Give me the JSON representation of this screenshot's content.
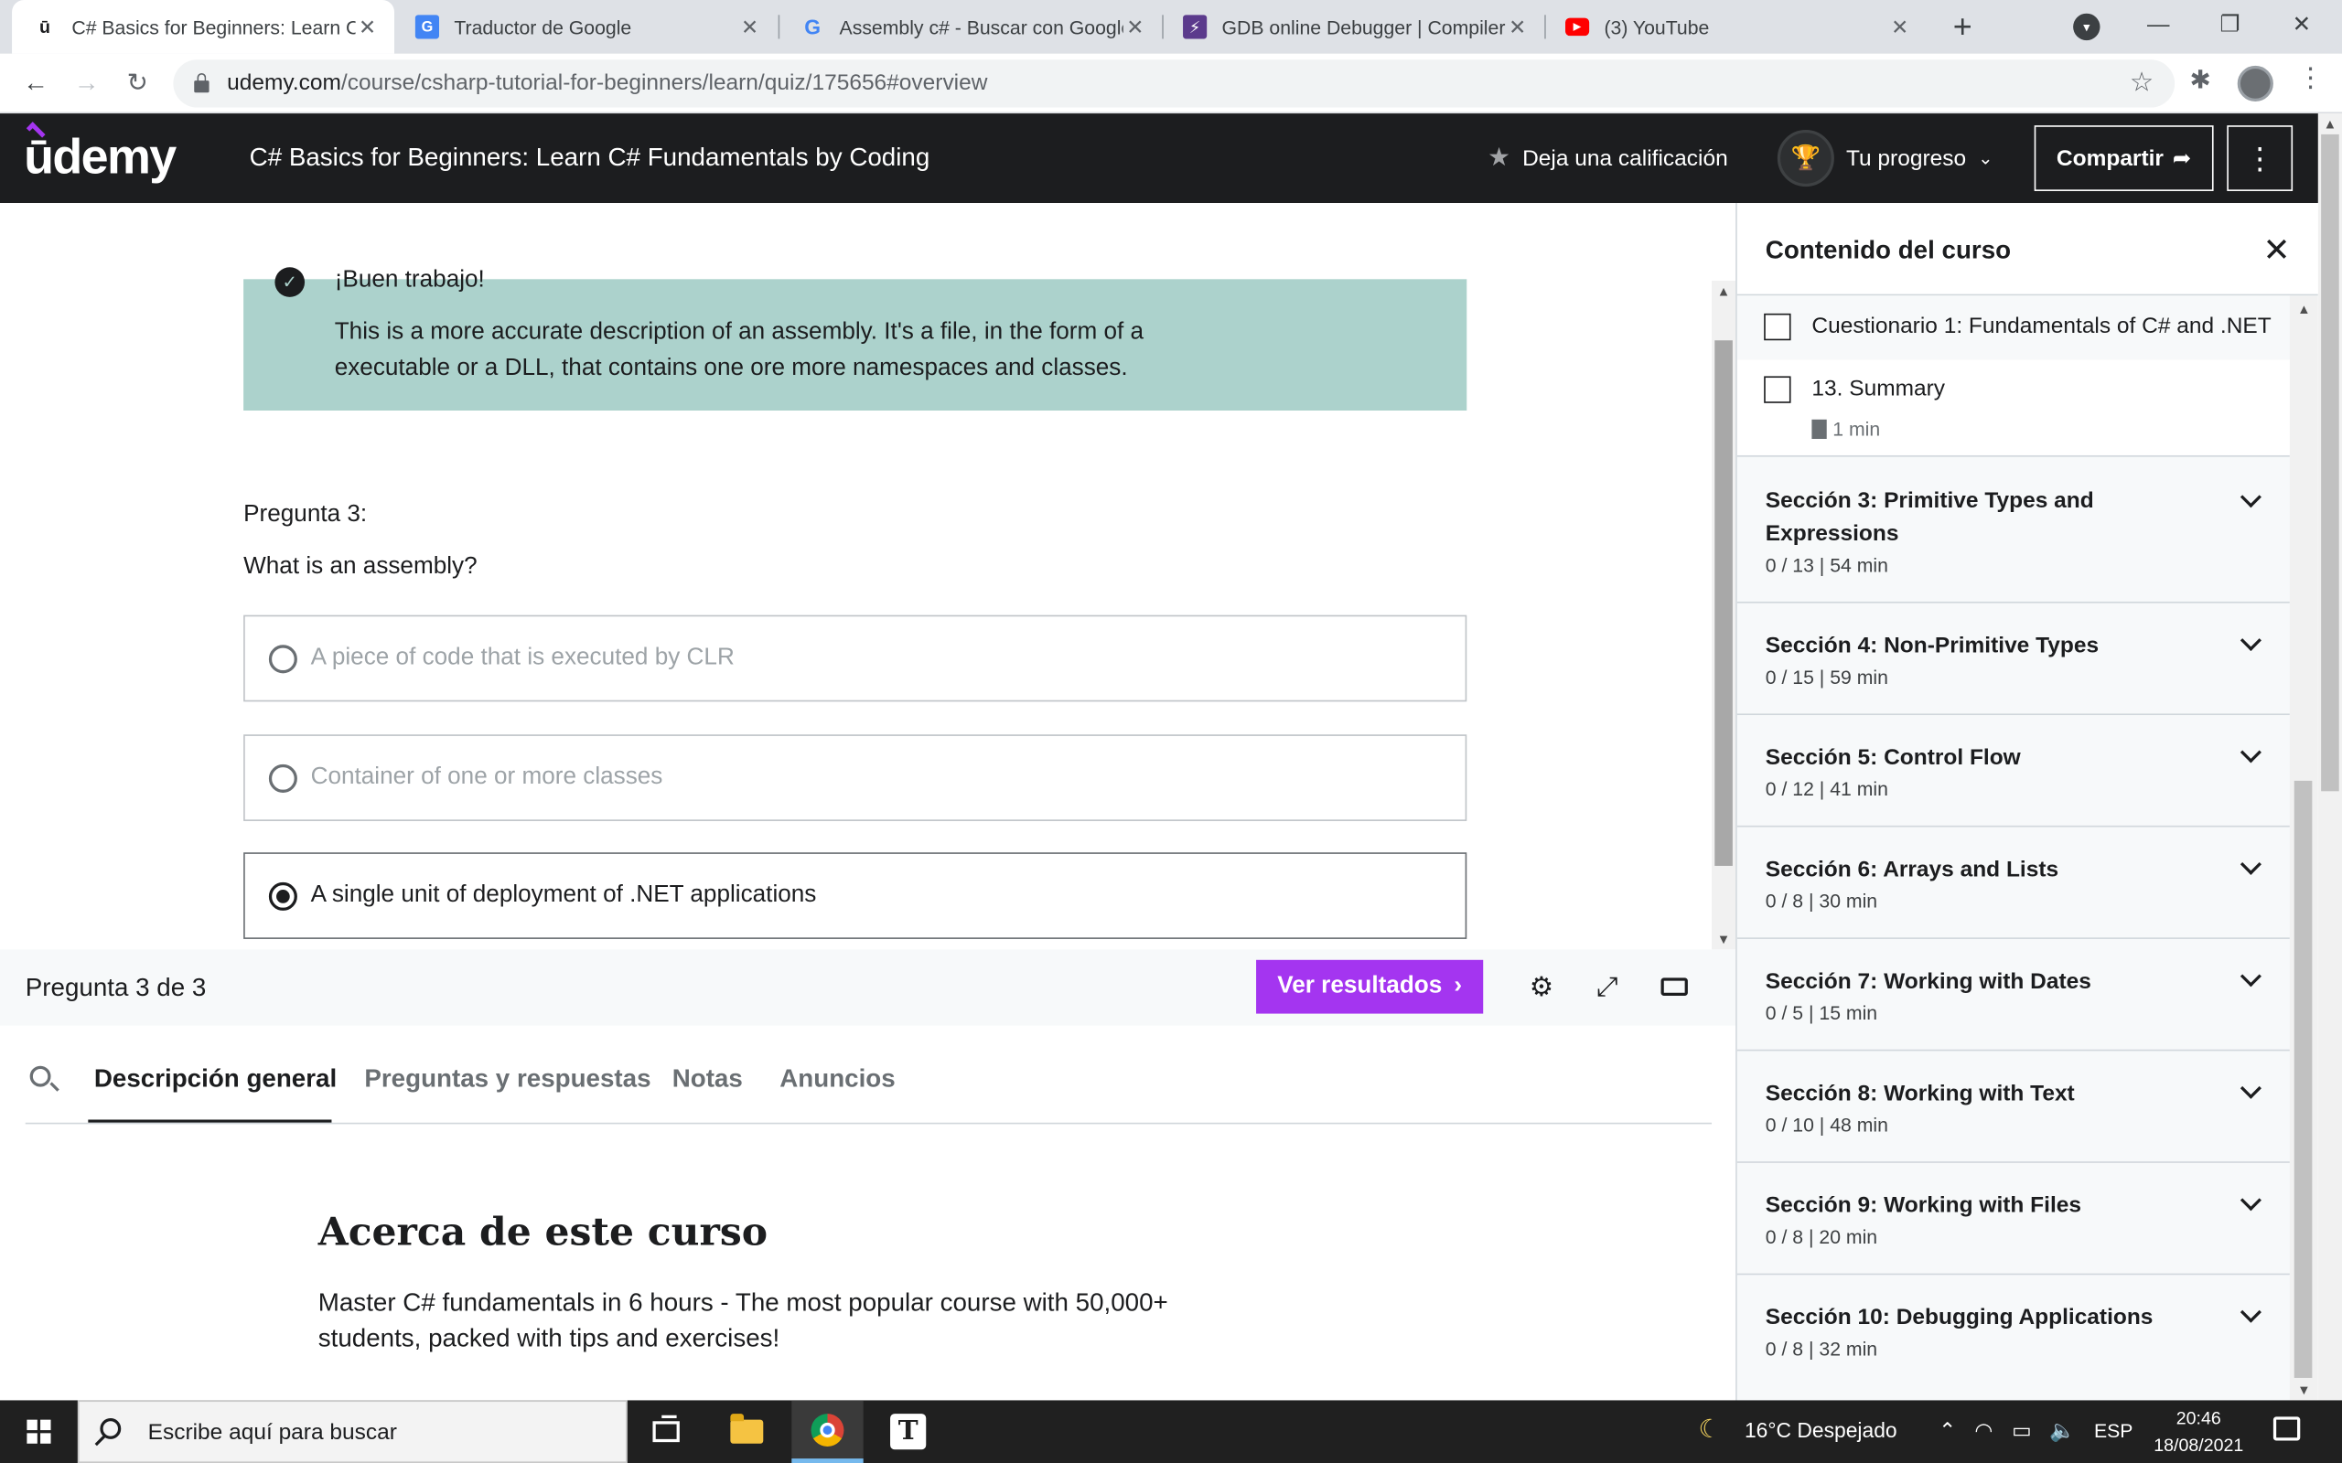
{
  "browser": {
    "tabs": [
      {
        "favicon": "udemy-favicon",
        "title": "C# Basics for Beginners: Learn C#",
        "active": true
      },
      {
        "favicon": "google-translate-favicon",
        "title": "Traductor de Google"
      },
      {
        "favicon": "google-favicon",
        "title": "Assembly c# - Buscar con Google"
      },
      {
        "favicon": "gdb-favicon",
        "title": "GDB online Debugger | Compiler"
      },
      {
        "favicon": "youtube-favicon",
        "title": "(3) YouTube"
      }
    ],
    "url_host": "udemy.com",
    "url_path": "/course/csharp-tutorial-for-beginners/learn/quiz/175656#overview"
  },
  "header": {
    "logo": "ūdemy",
    "course_title": "C# Basics for Beginners: Learn C# Fundamentals by Coding",
    "rate_label": "Deja una calificación",
    "progress_label": "Tu progreso",
    "share_label": "Compartir"
  },
  "quiz": {
    "feedback_title": "¡Buen trabajo!",
    "feedback_text": "This is a more accurate description of an assembly. It's a file, in the form of a executable or a DLL, that contains one ore more namespaces and classes.",
    "question_label": "Pregunta 3:",
    "question_text": "What is an assembly?",
    "options": [
      {
        "label": "A piece of code that is executed by CLR",
        "selected": false
      },
      {
        "label": "Container of one or more classes",
        "selected": false
      },
      {
        "label": "A single unit of deployment of .NET applications",
        "selected": true
      }
    ],
    "counter": "Pregunta 3 de 3",
    "results_button": "Ver resultados"
  },
  "lower_tabs": {
    "tabs": [
      "Descripción general",
      "Preguntas y respuestas",
      "Notas",
      "Anuncios"
    ],
    "about_title": "Acerca de este curso",
    "about_text": "Master C# fundamentals in 6 hours - The most popular course with 50,000+ students, packed with tips and exercises!"
  },
  "sidebar": {
    "title": "Contenido del curso",
    "lessons": [
      {
        "title": "Cuestionario 1: Fundamentals of C# and .NET"
      },
      {
        "title": "13. Summary",
        "meta": "1 min"
      }
    ],
    "sections": [
      {
        "title": "Sección 3: Primitive Types and Expressions",
        "meta": "0 / 13 | 54 min"
      },
      {
        "title": "Sección 4: Non-Primitive Types",
        "meta": "0 / 15 | 59 min"
      },
      {
        "title": "Sección 5: Control Flow",
        "meta": "0 / 12 | 41 min"
      },
      {
        "title": "Sección 6: Arrays and Lists",
        "meta": "0 / 8 | 30 min"
      },
      {
        "title": "Sección 7: Working with Dates",
        "meta": "0 / 5 | 15 min"
      },
      {
        "title": "Sección 8: Working with Text",
        "meta": "0 / 10 | 48 min"
      },
      {
        "title": "Sección 9: Working with Files",
        "meta": "0 / 8 | 20 min"
      },
      {
        "title": "Sección 10: Debugging Applications",
        "meta": "0 / 8 | 32 min"
      }
    ]
  },
  "taskbar": {
    "search_placeholder": "Escribe aquí para buscar",
    "weather": "16°C  Despejado",
    "language": "ESP",
    "time": "20:46",
    "date": "18/08/2021"
  },
  "colors": {
    "brand": "#a435f0",
    "header_bg": "#1c1d1f",
    "feedback_bg": "#acd2cc"
  }
}
